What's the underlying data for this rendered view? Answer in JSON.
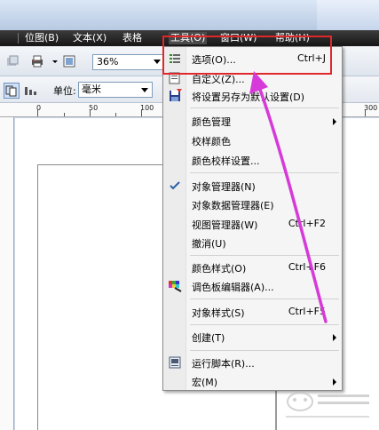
{
  "menubar": {
    "items": [
      {
        "label": "位图(B)"
      },
      {
        "label": "文本(X)"
      },
      {
        "label": "表格"
      },
      {
        "label": "工具(O)"
      },
      {
        "label": "窗口(W)"
      },
      {
        "label": "帮助(H)"
      }
    ]
  },
  "toolbar": {
    "zoom_value": "36%",
    "unit_label": "单位:",
    "unit_value": "毫米"
  },
  "ruler": {
    "labels": [
      "0",
      "50",
      "100",
      "300"
    ]
  },
  "tools_menu": {
    "items": [
      {
        "label": "选项(O)...",
        "shortcut": "Ctrl+J",
        "icon": "options-icon"
      },
      {
        "label": "自定义(Z)...",
        "shortcut": "",
        "icon": "customize-icon"
      },
      {
        "label": "将设置另存为默认设置(D)",
        "shortcut": "",
        "icon": "save-defaults-icon"
      },
      {
        "label": "颜色管理",
        "shortcut": "",
        "submenu": true
      },
      {
        "label": "校样颜色",
        "shortcut": ""
      },
      {
        "label": "颜色校样设置...",
        "shortcut": ""
      },
      {
        "label": "对象管理器(N)",
        "shortcut": "",
        "checked": true
      },
      {
        "label": "对象数据管理器(E)",
        "shortcut": ""
      },
      {
        "label": "视图管理器(W)",
        "shortcut": "Ctrl+F2"
      },
      {
        "label": "撤消(U)",
        "shortcut": ""
      },
      {
        "label": "颜色样式(O)",
        "shortcut": "Ctrl+F6"
      },
      {
        "label": "调色板编辑器(A)...",
        "shortcut": "",
        "icon": "palette-icon"
      },
      {
        "label": "对象样式(S)",
        "shortcut": "Ctrl+F5"
      },
      {
        "label": "创建(T)",
        "shortcut": "",
        "submenu": true
      },
      {
        "label": "运行脚本(R)...",
        "shortcut": "",
        "icon": "script-icon"
      },
      {
        "label": "宏(M)",
        "shortcut": "",
        "submenu": true
      }
    ]
  },
  "colors": {
    "highlight": "#e0282b",
    "arrow": "#d63ad8",
    "menubar_bg": "#1e1e1e"
  }
}
